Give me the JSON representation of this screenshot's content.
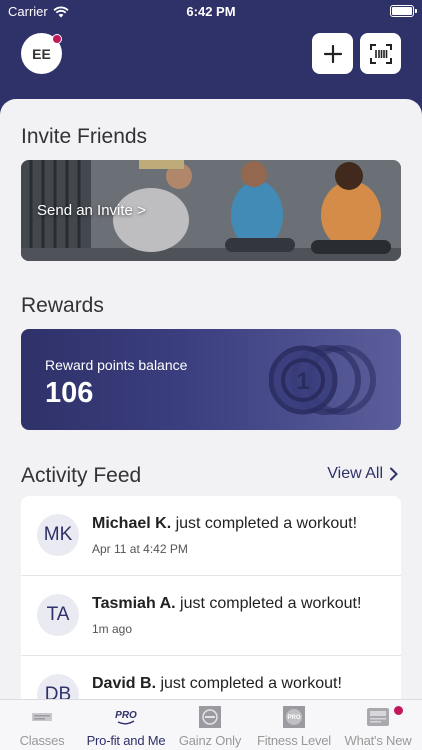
{
  "status_bar": {
    "carrier": "Carrier",
    "time": "6:42 PM"
  },
  "header": {
    "avatar_initials": "EE",
    "add_icon": "plus-icon",
    "scan_icon": "barcode-scan-icon"
  },
  "invite": {
    "title": "Invite Friends",
    "cta": "Send an Invite >"
  },
  "rewards": {
    "title": "Rewards",
    "balance_label": "Reward points balance",
    "balance_value": "106",
    "coin_glyph": "1"
  },
  "activity": {
    "title": "Activity Feed",
    "view_all": "View All",
    "items": [
      {
        "initials": "MK",
        "name": "Michael K.",
        "action": " just completed a workout!",
        "time": "Apr 11 at 4:42 PM"
      },
      {
        "initials": "TA",
        "name": "Tasmiah A.",
        "action": " just completed a workout!",
        "time": "1m ago"
      },
      {
        "initials": "DB",
        "name": "David B.",
        "action": " just completed a workout!",
        "time": ""
      }
    ]
  },
  "tabs": [
    {
      "label": "Classes",
      "icon": "classes-icon",
      "active": false
    },
    {
      "label": "Pro-fit and Me",
      "icon": "pro-fit-logo-icon",
      "logo_text": "PRO",
      "active": true
    },
    {
      "label": "Gainz Only",
      "icon": "gainz-logo-icon",
      "active": false
    },
    {
      "label": "Fitness Level",
      "icon": "fitness-level-logo-icon",
      "logo_text": "PRO",
      "active": false
    },
    {
      "label": "What's New",
      "icon": "whats-new-icon",
      "active": false,
      "badge": true
    }
  ],
  "colors": {
    "brand": "#2f3169",
    "badge": "#c2185b",
    "background": "#f2f2f5"
  }
}
